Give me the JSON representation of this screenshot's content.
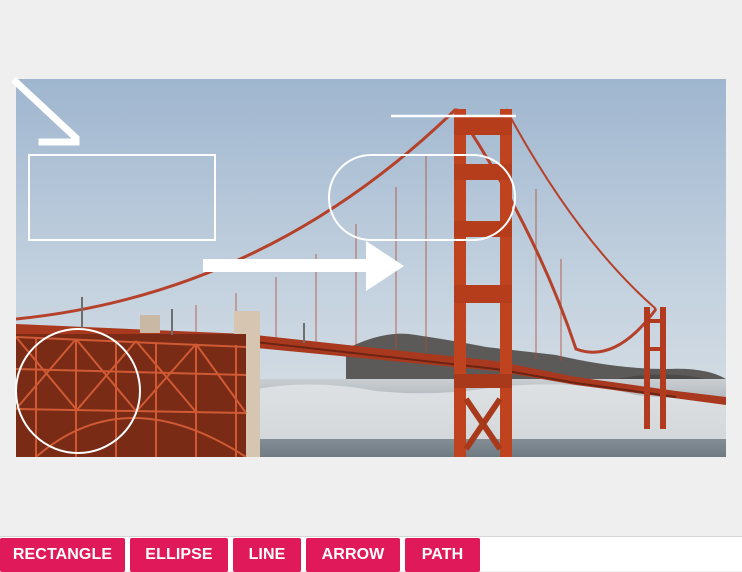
{
  "toolbar": {
    "buttons": [
      {
        "label": "RECTANGLE"
      },
      {
        "label": "ELLIPSE"
      },
      {
        "label": "LINE"
      },
      {
        "label": "ARROW"
      },
      {
        "label": "PATH"
      }
    ]
  },
  "colors": {
    "accent": "#e0195b",
    "page_background": "#efefef",
    "annotation_stroke": "#ffffff"
  },
  "image": {
    "subject": "suspension bridge over fog, red-orange towers, pale blue sky"
  },
  "annotations": [
    {
      "type": "path"
    },
    {
      "type": "rectangle"
    },
    {
      "type": "line"
    },
    {
      "type": "ellipse"
    },
    {
      "type": "arrow"
    },
    {
      "type": "ellipse"
    }
  ]
}
